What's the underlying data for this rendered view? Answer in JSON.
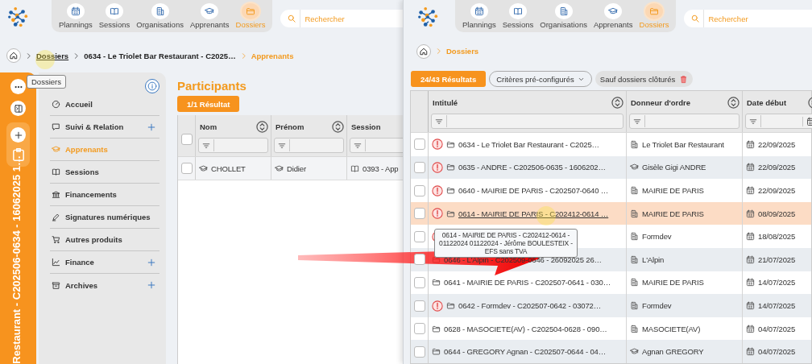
{
  "left_pane": {
    "nav": {
      "tabs": [
        {
          "label": "Plannings",
          "selected": false
        },
        {
          "label": "Sessions",
          "selected": false
        },
        {
          "label": "Organisations",
          "selected": false
        },
        {
          "label": "Apprenants",
          "selected": false
        },
        {
          "label": "Dossiers",
          "selected": true
        }
      ]
    },
    "search": {
      "placeholder": "Rechercher"
    },
    "breadcrumb": [
      {
        "label": "Dossiers",
        "kind": "link"
      },
      {
        "label": "0634 - Le Triolet Bar Restaurant - C2025…",
        "kind": "link"
      },
      {
        "label": "Apprenants",
        "kind": "current"
      }
    ],
    "tooltip": "Dossiers",
    "record_strip": {
      "title": "Restaurant - C202506-0634 - 16062025 1…"
    },
    "sidebar": {
      "items": [
        {
          "label": "Accueil",
          "selected": false,
          "addable": false
        },
        {
          "label": "Suivi & Relation",
          "selected": false,
          "addable": true
        },
        {
          "label": "Apprenants",
          "selected": true,
          "addable": false
        },
        {
          "label": "Sessions",
          "selected": false,
          "addable": false
        },
        {
          "label": "Financements",
          "selected": false,
          "addable": false
        },
        {
          "label": "Signatures numériques",
          "selected": false,
          "addable": false
        },
        {
          "label": "Autres produits",
          "selected": false,
          "addable": false
        },
        {
          "label": "Finance",
          "selected": false,
          "addable": true
        },
        {
          "label": "Archives",
          "selected": false,
          "addable": true
        }
      ]
    },
    "section_title": "Participants",
    "result_count": "1/1 Résultat",
    "table": {
      "all_checked": false,
      "columns": [
        {
          "label": "Nom"
        },
        {
          "label": "Prénom"
        },
        {
          "label": "Session"
        }
      ],
      "rows": [
        {
          "checked": false,
          "cells": [
            "CHOLLET",
            "Didier",
            "0393 - App"
          ]
        }
      ]
    }
  },
  "right_pane": {
    "nav": {
      "tabs": [
        {
          "label": "Plannings",
          "selected": false
        },
        {
          "label": "Sessions",
          "selected": false
        },
        {
          "label": "Organisations",
          "selected": false
        },
        {
          "label": "Apprenants",
          "selected": false
        },
        {
          "label": "Dossiers",
          "selected": true
        }
      ]
    },
    "search": {
      "placeholder": "Rechercher"
    },
    "breadcrumb": [
      {
        "label": "Dossiers",
        "kind": "current"
      }
    ],
    "result_count": "24/43 Résultats",
    "criteria_button": "Critères pré-configurés",
    "filter_chip": "Sauf dossiers clôturés",
    "table": {
      "columns": [
        {
          "label": "Intitulé",
          "kind": "text"
        },
        {
          "label": "Donneur d'ordre",
          "kind": "text"
        },
        {
          "label": "Date début",
          "kind": "date"
        }
      ],
      "rows": [
        {
          "checked": false,
          "alert": true,
          "highlighted": false,
          "title": "0634 - Le Triolet Bar Restaurant - C2025…",
          "client": {
            "label": "Le Triolet Bar Restaurant",
            "kind": "organisation"
          },
          "date": "22/09/2025"
        },
        {
          "checked": false,
          "alert": true,
          "highlighted": false,
          "title": "0635 - ANDRE - C202506-0635 - 1606202…",
          "client": {
            "label": "Gisèle Gigi ANDRE",
            "kind": "learner"
          },
          "date": "22/09/2025"
        },
        {
          "checked": false,
          "alert": true,
          "highlighted": false,
          "title": "0640 - MAIRIE DE PARIS - C202507-0640 …",
          "client": {
            "label": "MAIRIE DE PARIS",
            "kind": "organisation"
          },
          "date": "22/09/2025"
        },
        {
          "checked": false,
          "alert": true,
          "highlighted": true,
          "title": "0614 - MAIRIE DE PARIS - C202412-0614 …",
          "client": {
            "label": "MAIRIE DE PARIS",
            "kind": "organisation"
          },
          "date": "08/09/2025"
        },
        {
          "checked": false,
          "alert": true,
          "highlighted": false,
          "client": {
            "label": "Formdev",
            "kind": "organisation"
          },
          "date": "18/08/2025"
        },
        {
          "checked": false,
          "alert": false,
          "highlighted": false,
          "title": "0646 - L'Alpin - C202509-0646 - 26092025 26…",
          "client": {
            "label": "L'Alpin",
            "kind": "organisation"
          },
          "date": "21/07/2025"
        },
        {
          "checked": false,
          "alert": false,
          "highlighted": false,
          "title": "0641 - MAIRIE DE PARIS - C202507-0641 - 030…",
          "client": {
            "label": "MAIRIE DE PARIS",
            "kind": "organisation"
          },
          "date": "14/07/2025"
        },
        {
          "checked": false,
          "alert": true,
          "highlighted": false,
          "title": "0642 - Formdev - C202507-0642 - 03072…",
          "client": {
            "label": "Formdev",
            "kind": "organisation"
          },
          "date": "14/07/2025"
        },
        {
          "checked": false,
          "alert": false,
          "highlighted": false,
          "title": "0628 - MASOCIETE(AV) - C202504-0628 - 090…",
          "client": {
            "label": "MASOCIETE(AV)",
            "kind": "organisation"
          },
          "date": "04/07/2025"
        },
        {
          "checked": false,
          "alert": false,
          "highlighted": false,
          "title": "0644 - GREGORY Agnan - C202507-0644 - 04…",
          "client": {
            "label": "Agnan GREGORY",
            "kind": "learner"
          },
          "date": "04/07/2025"
        }
      ]
    },
    "tooltip": "0614 - MAIRIE DE PARIS - C202412-0614 - 01122024 01122024 - Jérôme BOULESTEIX - EFS sans TVA"
  }
}
